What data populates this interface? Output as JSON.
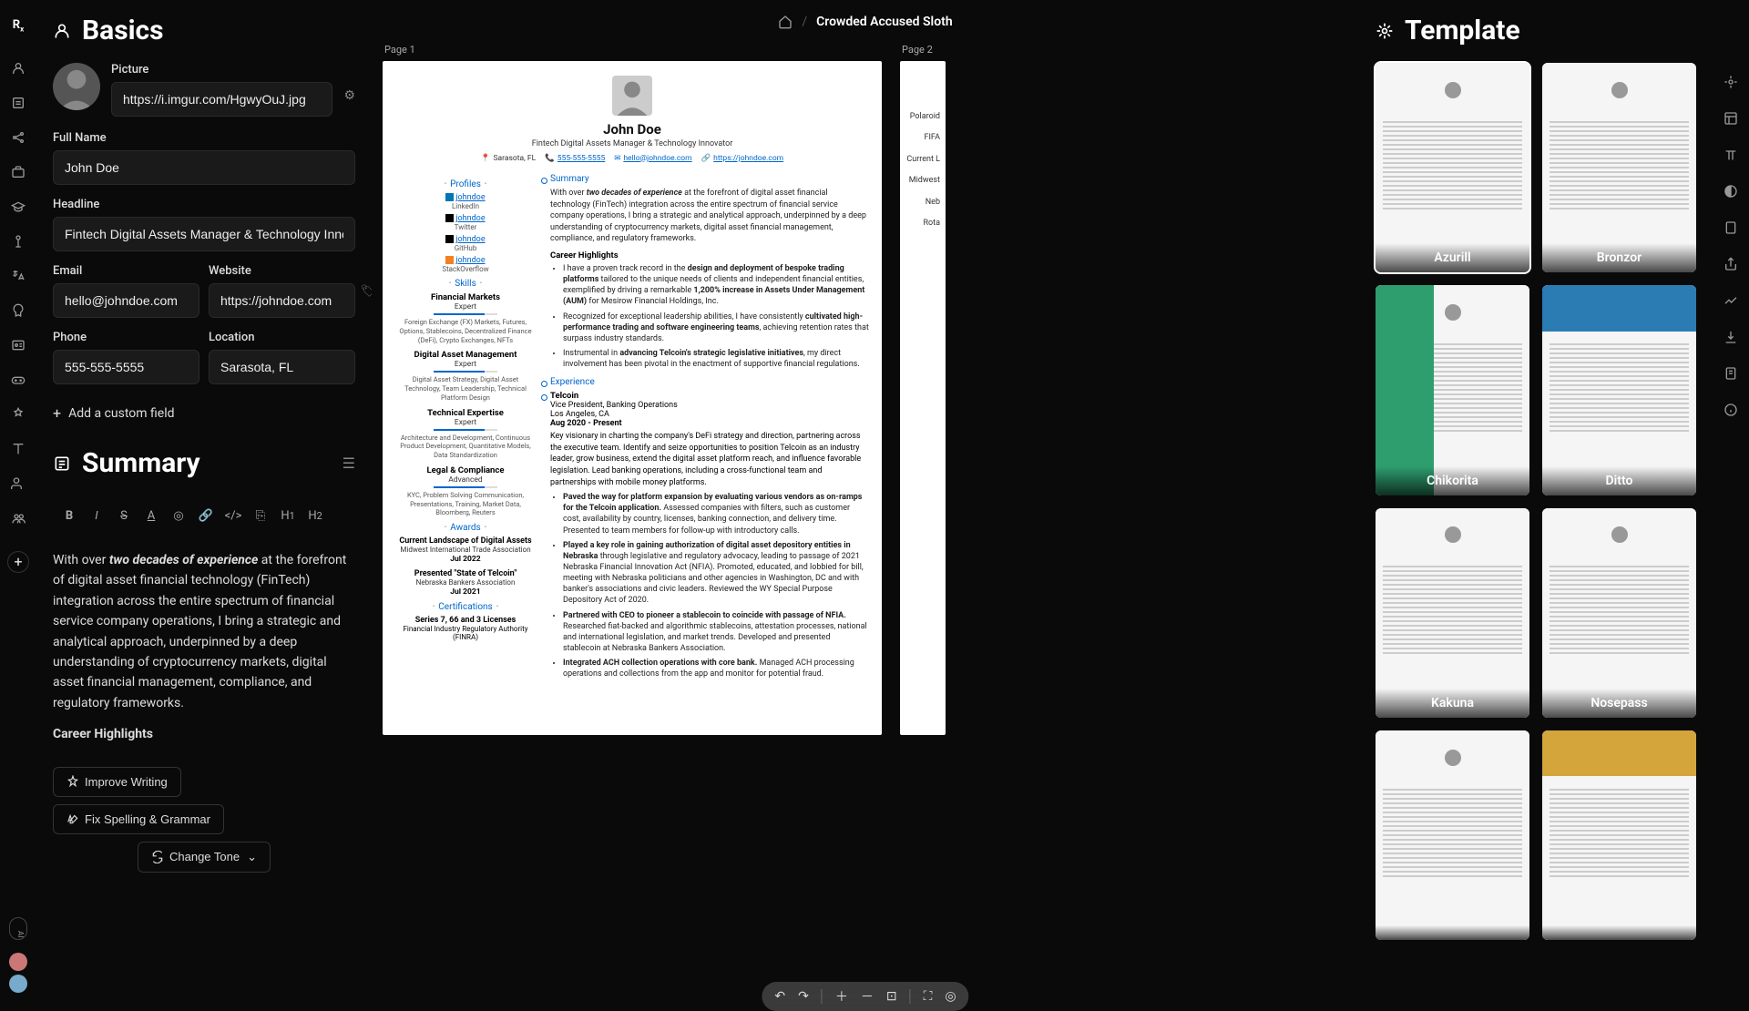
{
  "breadcrumb": {
    "current": "Crowded Accused Sloth"
  },
  "basics": {
    "title": "Basics",
    "picture_label": "Picture",
    "picture_url": "https://i.imgur.com/HgwyOuJ.jpg",
    "fullname_label": "Full Name",
    "fullname": "John Doe",
    "headline_label": "Headline",
    "headline": "Fintech Digital Assets Manager & Technology Innovator",
    "email_label": "Email",
    "email": "hello@johndoe.com",
    "website_label": "Website",
    "website": "https://johndoe.com",
    "phone_label": "Phone",
    "phone": "555-555-5555",
    "location_label": "Location",
    "location": "Sarasota, FL",
    "add_field": "Add a custom field"
  },
  "summary": {
    "title": "Summary",
    "body_prefix": "With over ",
    "body_bold": "two decades of experience",
    "body_rest": " at the forefront of digital asset financial technology (FinTech) integration across the entire spectrum of financial service company operations, I bring a strategic and analytical approach, underpinned by a deep understanding of cryptocurrency markets, digital asset financial management, compliance, and regulatory frameworks.",
    "career_h": "Career Highlights",
    "improve": "Improve Writing",
    "fix": "Fix Spelling & Grammar",
    "tone": "Change Tone"
  },
  "template": {
    "title": "Template"
  },
  "templates": [
    {
      "name": "Azurill",
      "selected": true,
      "accent": "#ffffff"
    },
    {
      "name": "Bronzor",
      "accent": "#ffffff"
    },
    {
      "name": "Chikorita",
      "accent": "#2e9e6f",
      "layout": "left"
    },
    {
      "name": "Ditto",
      "accent": "#2b7cb3",
      "layout": "top"
    },
    {
      "name": "Kakuna",
      "accent": "#ffffff"
    },
    {
      "name": "Nosepass",
      "accent": "#ffffff"
    },
    {
      "name": "",
      "accent": "#ffffff"
    },
    {
      "name": "",
      "accent": "#d4a53a",
      "layout": "top"
    }
  ],
  "pages": {
    "p1": "Page 1",
    "p2": "Page 2"
  },
  "page2_lines": [
    "Polaroid",
    "FIFA",
    "Current L",
    "Midwest",
    "Neb",
    "Rota"
  ],
  "resume": {
    "name": "John Doe",
    "headline": "Fintech Digital Assets Manager & Technology Innovator",
    "location": "Sarasota, FL",
    "phone": "555-555-5555",
    "email": "hello@johndoe.com",
    "website": "https://johndoe.com",
    "sections": {
      "profiles": "Profiles",
      "skills": "Skills",
      "awards": "Awards",
      "certs": "Certifications",
      "summary": "Summary",
      "experience": "Experience"
    },
    "profiles": [
      {
        "handle": "johndoe",
        "site": "LinkedIn",
        "color": "#0077b5"
      },
      {
        "handle": "johndoe",
        "site": "Twitter",
        "color": "#000"
      },
      {
        "handle": "johndoe",
        "site": "GitHub",
        "color": "#000"
      },
      {
        "handle": "johndoe",
        "site": "StackOverflow",
        "color": "#f48024"
      }
    ],
    "skills": [
      {
        "name": "Financial Markets",
        "level": "Expert",
        "tags": "Foreign Exchange (FX) Markets, Futures, Options, Stablecoins, Decentralized Finance (DeFi), Crypto Exchanges, NFTs"
      },
      {
        "name": "Digital Asset Management",
        "level": "Expert",
        "tags": "Digital Asset Strategy, Digital Asset Technology, Team Leadership, Technical Platform Design"
      },
      {
        "name": "Technical Expertise",
        "level": "Expert",
        "tags": "Architecture and Development, Continuous Product Development, Quantitative Models, Data Standardization"
      },
      {
        "name": "Legal & Compliance",
        "level": "Advanced",
        "tags": "KYC, Problem Solving Communication, Presentations, Training, Market Data, Bloomberg, Reuters"
      }
    ],
    "awards": [
      {
        "name": "Current Landscape of Digital Assets",
        "org": "Midwest International Trade Association",
        "date": "Jul 2022"
      },
      {
        "name": "Presented \"State of Telcoin\"",
        "org": "Nebraska Bankers Association",
        "date": "Jul 2021"
      }
    ],
    "certs": [
      {
        "name": "Series 7, 66 and 3 Licenses",
        "org": "Financial Industry Regulatory Authority (FINRA)"
      }
    ],
    "summary_text_pre": "With over ",
    "summary_text_bold": "two decades of experience",
    "summary_text_post": " at the forefront of digital asset financial technology (FinTech) integration across the entire spectrum of financial service company operations, I bring a strategic and analytical approach, underpinned by a deep understanding of cryptocurrency markets, digital asset financial management, compliance, and regulatory frameworks.",
    "career_h": "Career Highlights",
    "highlights": [
      {
        "pre": "I have a proven track record in the ",
        "b1": "design and deployment of bespoke trading platforms",
        "mid": " tailored to the unique needs of clients and independent financial entities, exemplified by driving a remarkable ",
        "b2": "1,200% increase in Assets Under Management (AUM)",
        "post": " for Mesirow Financial Holdings, Inc."
      },
      {
        "pre": "Recognized for exceptional leadership abilities, I have consistently ",
        "b1": "cultivated high-performance trading and software engineering teams",
        "mid": ", achieving retention rates that surpass industry standards.",
        "b2": "",
        "post": ""
      },
      {
        "pre": "Instrumental in ",
        "b1": "advancing Telcoin's strategic legislative initiatives",
        "mid": ", my direct involvement has been pivotal in the enactment of supportive financial regulations.",
        "b2": "",
        "post": ""
      }
    ],
    "exp": {
      "company": "Telcoin",
      "role": "Vice President, Banking Operations",
      "loc": "Los Angeles, CA",
      "date": "Aug 2020 - Present",
      "desc": "Key visionary in charting the company's DeFi strategy and direction, partnering across the executive team. Identify and seize opportunities to position Telcoin as an industry leader, grow business, extend the digital asset platform reach, and influence favorable legislation. Lead banking operations, including a cross-functional team and partnerships with mobile money platforms.",
      "bullets": [
        {
          "b": "Paved the way for platform expansion by evaluating various vendors as on-ramps for the Telcoin application.",
          "rest": " Assessed companies with filters, such as customer cost, availability by country, licenses, banking connection, and delivery time. Presented to team members for follow-up with introductory calls."
        },
        {
          "b": "Played a key role in gaining authorization of digital asset depository entities in Nebraska",
          "rest": " through legislative and regulatory advocacy, leading to passage of 2021 Nebraska Financial Innovation Act (NFIA). Promoted, educated, and lobbied for bill, meeting with Nebraska politicians and other agencies in Washington, DC and with banker's associations and civic leaders. Reviewed the WY Special Purpose Depository Act of 2020."
        },
        {
          "b": "Partnered with CEO to pioneer a stablecoin to coincide with passage of NFIA.",
          "rest": " Researched fiat-backed and algorithmic stablecoins, attestation processes, national and international legislation, and market trends. Developed and presented stablecoin at Nebraska Bankers Association."
        },
        {
          "b": "Integrated ACH collection operations with core bank.",
          "rest": " Managed ACH processing operations and collections from the app and monitor for potential fraud."
        }
      ]
    }
  }
}
